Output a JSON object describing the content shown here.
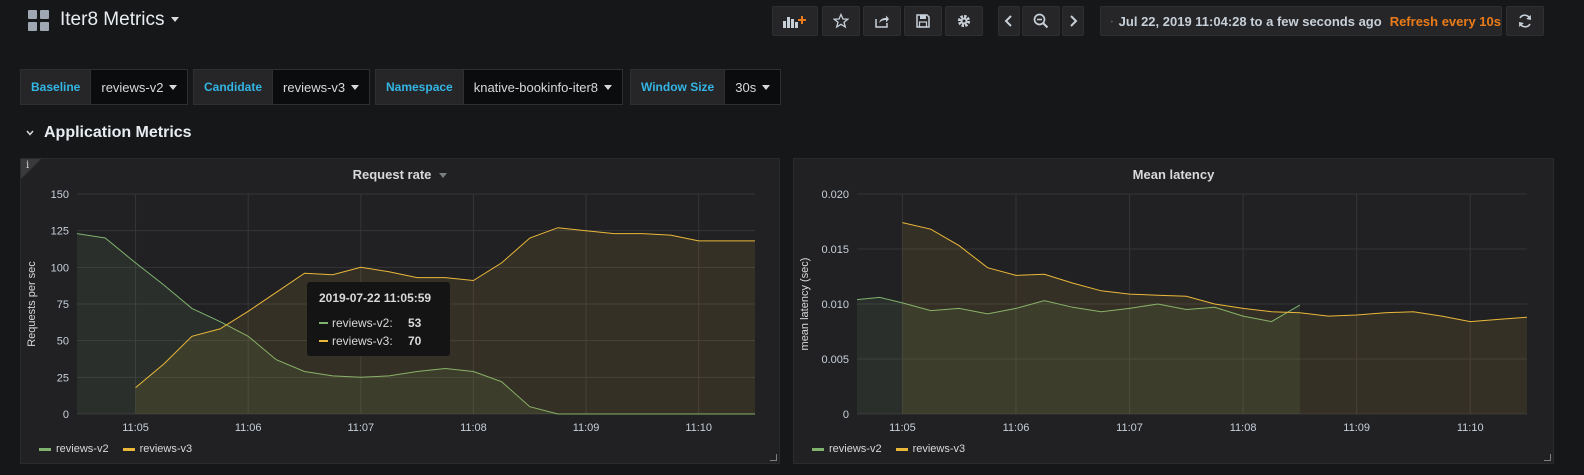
{
  "header": {
    "title": "Iter8 Metrics",
    "time_range": "Jul 22, 2019 11:04:28 to a few seconds ago",
    "refresh": "Refresh every 10s"
  },
  "variables": [
    {
      "label": "Baseline",
      "value": "reviews-v2"
    },
    {
      "label": "Candidate",
      "value": "reviews-v3"
    },
    {
      "label": "Namespace",
      "value": "knative-bookinfo-iter8"
    },
    {
      "label": "Window Size",
      "value": "30s"
    }
  ],
  "row": {
    "title": "Application Metrics"
  },
  "colors": {
    "v2": "#7eb26d",
    "v3": "#eab839",
    "accent": "#33b5e5",
    "refresh": "#eb7b18"
  },
  "tooltip": {
    "time": "2019-07-22 11:05:59",
    "rows": [
      {
        "name": "reviews-v2:",
        "value": "53"
      },
      {
        "name": "reviews-v3:",
        "value": "70"
      }
    ]
  },
  "chart_data": [
    {
      "type": "area",
      "title": "Request rate",
      "ylabel": "Requests per sec",
      "xlabel": "",
      "x_ticks": [
        "11:05",
        "11:06",
        "11:07",
        "11:08",
        "11:09",
        "11:10"
      ],
      "x_tick_minutes": [
        5,
        6,
        7,
        8,
        9,
        10
      ],
      "xlim_minutes": [
        4.48,
        10.5
      ],
      "ylim": [
        0,
        150
      ],
      "y_ticks": [
        0,
        25,
        50,
        75,
        100,
        125,
        150
      ],
      "y_format": "int",
      "grid": true,
      "legend": "bottom-left",
      "series": [
        {
          "name": "reviews-v2",
          "color": "#7eb26d",
          "x": [
            4.48,
            4.73,
            5.0,
            5.25,
            5.5,
            5.75,
            6.0,
            6.25,
            6.5,
            6.75,
            7.0,
            7.25,
            7.5,
            7.75,
            8.0,
            8.25,
            8.5,
            8.75,
            9.0,
            9.25,
            9.5,
            9.75,
            10.0,
            10.25,
            10.5
          ],
          "y": [
            123,
            120,
            103,
            88,
            72,
            63,
            53,
            37,
            29,
            26,
            25,
            26,
            29,
            31,
            29,
            22,
            5,
            0,
            0,
            0,
            0,
            0,
            0,
            0,
            0
          ]
        },
        {
          "name": "reviews-v3",
          "color": "#eab839",
          "x": [
            5.0,
            5.25,
            5.5,
            5.75,
            6.0,
            6.25,
            6.5,
            6.75,
            7.0,
            7.25,
            7.5,
            7.75,
            8.0,
            8.25,
            8.5,
            8.75,
            9.0,
            9.25,
            9.5,
            9.75,
            10.0,
            10.25,
            10.5
          ],
          "y": [
            18,
            34,
            53,
            58,
            70,
            83,
            96,
            95,
            100,
            97,
            93,
            93,
            91,
            103,
            120,
            127,
            125,
            123,
            123,
            122,
            118,
            118,
            118
          ]
        }
      ]
    },
    {
      "type": "area",
      "title": "Mean latency",
      "ylabel": "mean latency (sec)",
      "xlabel": "",
      "x_ticks": [
        "11:05",
        "11:06",
        "11:07",
        "11:08",
        "11:09",
        "11:10"
      ],
      "x_tick_minutes": [
        5,
        6,
        7,
        8,
        9,
        10
      ],
      "xlim_minutes": [
        4.6,
        10.5
      ],
      "ylim": [
        0,
        0.02
      ],
      "y_ticks": [
        0,
        0.005,
        0.01,
        0.015,
        0.02
      ],
      "y_format": "lat",
      "grid": true,
      "legend": "bottom-left",
      "series": [
        {
          "name": "reviews-v2",
          "color": "#7eb26d",
          "x": [
            4.6,
            4.8,
            5.0,
            5.25,
            5.5,
            5.75,
            6.0,
            6.25,
            6.5,
            6.75,
            7.0,
            7.25,
            7.5,
            7.75,
            8.0,
            8.25,
            8.5
          ],
          "y": [
            0.0104,
            0.0106,
            0.0101,
            0.0094,
            0.0096,
            0.0091,
            0.0096,
            0.0103,
            0.0097,
            0.0093,
            0.0096,
            0.01,
            0.0095,
            0.0097,
            0.0089,
            0.0084,
            0.0099
          ]
        },
        {
          "name": "reviews-v3",
          "color": "#eab839",
          "x": [
            5.0,
            5.25,
            5.5,
            5.75,
            6.0,
            6.25,
            6.5,
            6.75,
            7.0,
            7.25,
            7.5,
            7.75,
            8.0,
            8.25,
            8.5,
            8.75,
            9.0,
            9.25,
            9.5,
            9.75,
            10.0,
            10.25,
            10.5
          ],
          "y": [
            0.0174,
            0.0168,
            0.0153,
            0.0133,
            0.0126,
            0.0127,
            0.0119,
            0.0112,
            0.0109,
            0.0108,
            0.0107,
            0.01,
            0.0096,
            0.0093,
            0.0092,
            0.0089,
            0.009,
            0.0092,
            0.0093,
            0.0089,
            0.0084,
            0.0086,
            0.0088
          ]
        }
      ]
    }
  ]
}
